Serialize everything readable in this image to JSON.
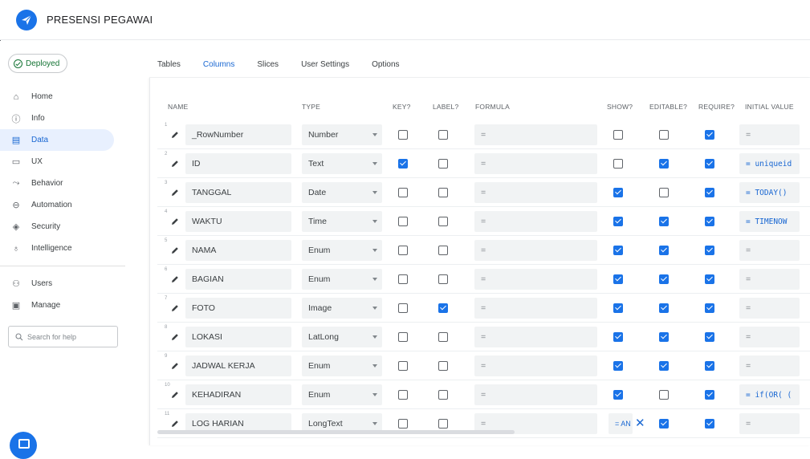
{
  "app": {
    "title": "PRESENSI PEGAWAI"
  },
  "deploy": {
    "status": "Deployed"
  },
  "nav": {
    "items": [
      {
        "label": "Home",
        "icon": "home-icon"
      },
      {
        "label": "Info",
        "icon": "info-icon"
      },
      {
        "label": "Data",
        "icon": "table-icon",
        "active": true
      },
      {
        "label": "UX",
        "icon": "screen-icon"
      },
      {
        "label": "Behavior",
        "icon": "behavior-icon"
      },
      {
        "label": "Automation",
        "icon": "robot-icon"
      },
      {
        "label": "Security",
        "icon": "shield-icon"
      },
      {
        "label": "Intelligence",
        "icon": "bulb-icon"
      }
    ],
    "items2": [
      {
        "label": "Users",
        "icon": "users-icon"
      },
      {
        "label": "Manage",
        "icon": "manage-icon"
      }
    ],
    "search_placeholder": "Search for help"
  },
  "tabs": [
    "Tables",
    "Columns",
    "Slices",
    "User Settings",
    "Options"
  ],
  "active_tab": 1,
  "columns": {
    "name": "NAME",
    "type": "TYPE",
    "key": "KEY?",
    "label": "LABEL?",
    "formula": "FORMULA",
    "show": "SHOW?",
    "editable": "EDITABLE?",
    "require": "REQUIRE?",
    "initial": "INITIAL VALUE"
  },
  "rows": [
    {
      "num": "1",
      "name": "_RowNumber",
      "type": "Number",
      "key": false,
      "label": false,
      "formula": "=",
      "show": false,
      "editable": false,
      "require": true,
      "initial": "=",
      "initial_code": false
    },
    {
      "num": "2",
      "name": "ID",
      "type": "Text",
      "key": true,
      "label": false,
      "formula": "=",
      "show": false,
      "editable": true,
      "require": true,
      "initial": "= uniqueid",
      "initial_code": true
    },
    {
      "num": "3",
      "name": "TANGGAL",
      "type": "Date",
      "key": false,
      "label": false,
      "formula": "=",
      "show": true,
      "editable": false,
      "require": true,
      "initial": "= TODAY()",
      "initial_code": true
    },
    {
      "num": "4",
      "name": "WAKTU",
      "type": "Time",
      "key": false,
      "label": false,
      "formula": "=",
      "show": true,
      "editable": true,
      "require": true,
      "initial": "= TIMENOW",
      "initial_code": true
    },
    {
      "num": "5",
      "name": "NAMA",
      "type": "Enum",
      "key": false,
      "label": false,
      "formula": "=",
      "show": true,
      "editable": true,
      "require": true,
      "initial": "=",
      "initial_code": false
    },
    {
      "num": "6",
      "name": "BAGIAN",
      "type": "Enum",
      "key": false,
      "label": false,
      "formula": "=",
      "show": true,
      "editable": true,
      "require": true,
      "initial": "=",
      "initial_code": false
    },
    {
      "num": "7",
      "name": "FOTO",
      "type": "Image",
      "key": false,
      "label": true,
      "formula": "=",
      "show": true,
      "editable": true,
      "require": true,
      "initial": "=",
      "initial_code": false
    },
    {
      "num": "8",
      "name": "LOKASI",
      "type": "LatLong",
      "key": false,
      "label": false,
      "formula": "=",
      "show": true,
      "editable": true,
      "require": true,
      "initial": "=",
      "initial_code": false
    },
    {
      "num": "9",
      "name": "JADWAL KERJA",
      "type": "Enum",
      "key": false,
      "label": false,
      "formula": "=",
      "show": true,
      "editable": true,
      "require": true,
      "initial": "=",
      "initial_code": false
    },
    {
      "num": "10",
      "name": "KEHADIRAN",
      "type": "Enum",
      "key": false,
      "label": false,
      "formula": "=",
      "show": true,
      "editable": false,
      "require": true,
      "initial": "= if(OR( (",
      "initial_code": true
    },
    {
      "num": "11",
      "name": "LOG HARIAN",
      "type": "LongText",
      "key": false,
      "label": false,
      "formula": "=",
      "show_text": "= AN",
      "show_x": "✕",
      "editable": true,
      "require": true,
      "initial": "=",
      "initial_code": false
    }
  ]
}
